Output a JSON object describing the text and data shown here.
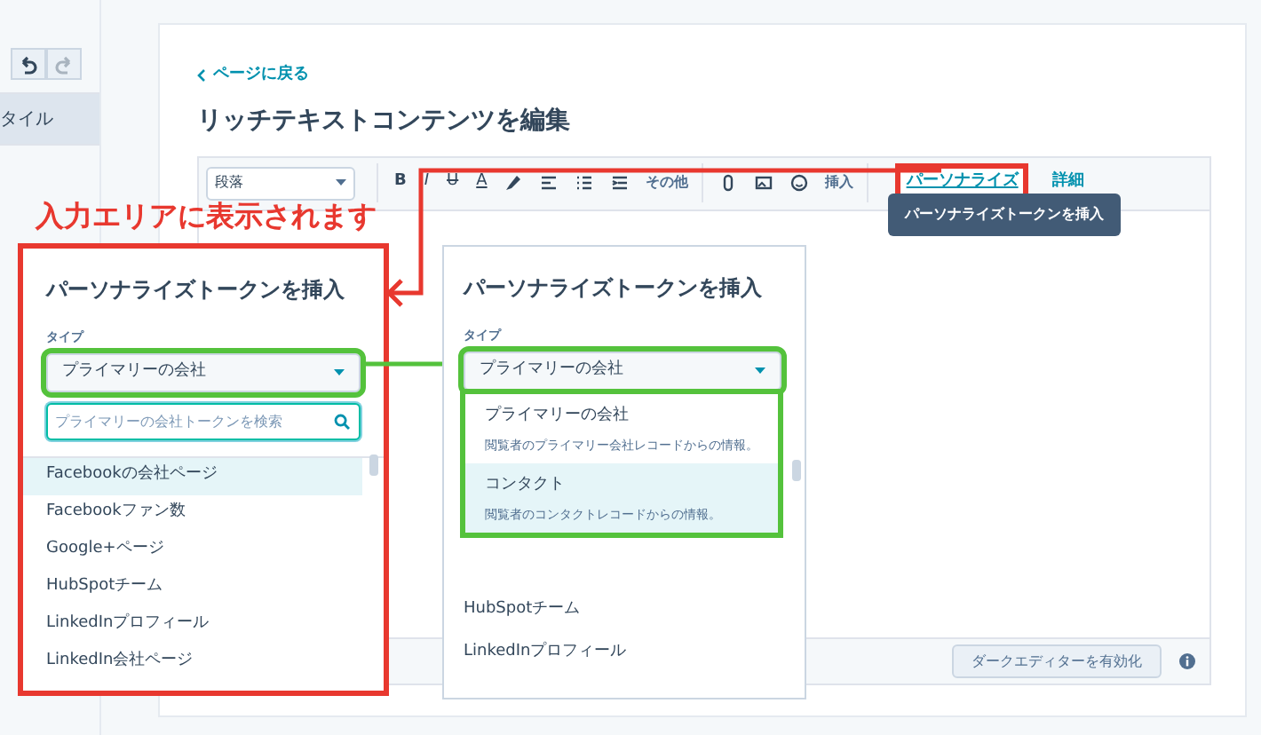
{
  "sidebar": {
    "history_buttons": [
      {
        "kind": "undo",
        "disabled": false
      },
      {
        "kind": "redo",
        "disabled": true
      }
    ],
    "items": [
      {
        "label": "タイル",
        "selected": true
      }
    ]
  },
  "back_link": "ページに戻る",
  "title": "リッチテキストコンテンツを編集",
  "toolbar": {
    "paragraph_select": "段落",
    "format_buttons": [
      "B",
      "I",
      "U",
      "A"
    ],
    "more_menu": "その他",
    "insert_menu": "挿入",
    "personalize": {
      "label": "パーソナライズ",
      "highlighted": true
    },
    "details_menu": "詳細"
  },
  "tooltip": "パーソナライズトークンを挿入",
  "footer_button": "ダークエディターを有効化",
  "annotation": "入力エリアに表示されます",
  "left_panel": {
    "highlighted": true,
    "title": "パーソナライズトークンを挿入",
    "type_label": "タイプ",
    "type_select": {
      "value": "プライマリーの会社",
      "highlighted": true
    },
    "search_placeholder": "プライマリーの会社トークンを検索",
    "tokens": [
      {
        "label": "Facebookの会社ページ",
        "selected": true
      },
      {
        "label": "Facebookファン数",
        "selected": false
      },
      {
        "label": "Google+ページ",
        "selected": false
      },
      {
        "label": "HubSpotチーム",
        "selected": false
      },
      {
        "label": "LinkedInプロフィール",
        "selected": false
      },
      {
        "label": "LinkedIn会社ページ",
        "selected": false
      }
    ]
  },
  "right_panel": {
    "title": "パーソナライズトークンを挿入",
    "type_label": "タイプ",
    "type_select": {
      "value": "プライマリーの会社",
      "highlighted": true
    },
    "options": [
      {
        "label": "プライマリーの会社",
        "description": "閲覧者のプライマリー会社レコードからの情報。",
        "selected": false
      },
      {
        "label": "コンタクト",
        "description": "閲覧者のコンタクトレコードからの情報。",
        "selected": true
      }
    ],
    "tokens": [
      {
        "label": "HubSpotチーム"
      },
      {
        "label": "LinkedInプロフィール"
      }
    ]
  }
}
